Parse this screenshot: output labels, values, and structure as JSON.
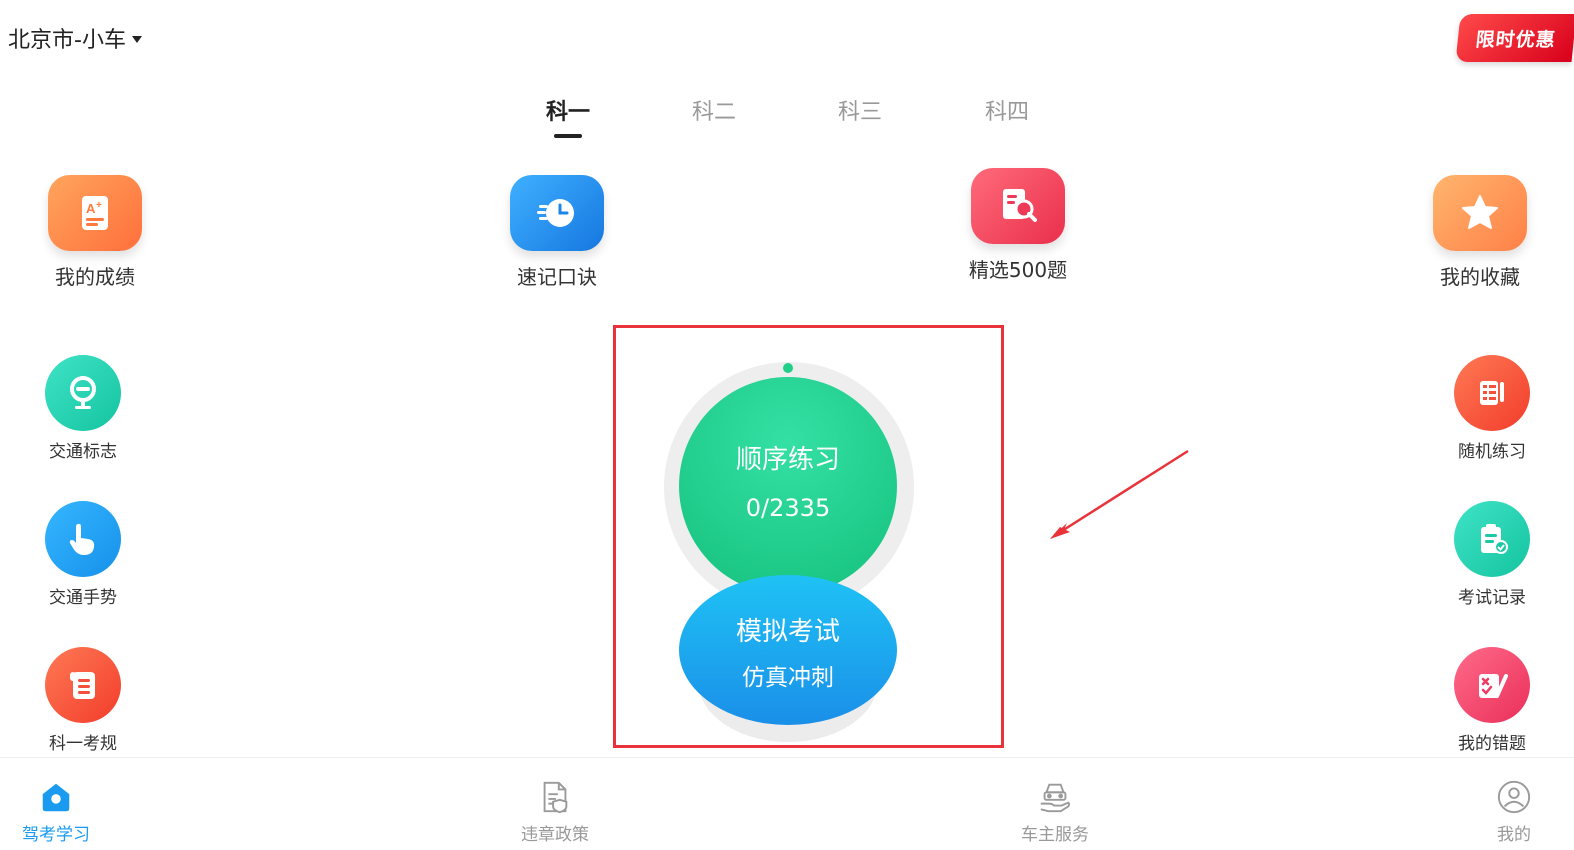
{
  "header": {
    "city": "北京市-小车",
    "promo": "限时优惠"
  },
  "tabs": [
    {
      "label": "科一",
      "active": true
    },
    {
      "label": "科二",
      "active": false
    },
    {
      "label": "科三",
      "active": false
    },
    {
      "label": "科四",
      "active": false
    }
  ],
  "features": [
    {
      "label": "我的成绩",
      "icon": "grade-icon",
      "color": "#ff8a4c"
    },
    {
      "label": "速记口诀",
      "icon": "timer-icon",
      "color": "#2196f3"
    },
    {
      "label": "精选500题",
      "icon": "search-doc-icon",
      "color": "#f2485f"
    },
    {
      "label": "我的收藏",
      "icon": "star-icon",
      "color": "#ff9a5a"
    }
  ],
  "left_tools": [
    {
      "label": "交通标志",
      "icon": "traffic-sign-icon",
      "color": "#22d3b0"
    },
    {
      "label": "交通手势",
      "icon": "hand-gesture-icon",
      "color": "#1aa4f0"
    },
    {
      "label": "科一考规",
      "icon": "rules-scroll-icon",
      "color": "#f7523e"
    }
  ],
  "right_tools": [
    {
      "label": "随机练习",
      "icon": "random-list-icon",
      "color": "#f7523e"
    },
    {
      "label": "考试记录",
      "icon": "exam-record-icon",
      "color": "#22d3b0"
    },
    {
      "label": "我的错题",
      "icon": "wrong-answers-icon",
      "color": "#f04a6e"
    }
  ],
  "practice": {
    "title": "顺序练习",
    "progress": "0/2335"
  },
  "exam": {
    "title": "模拟考试",
    "subtitle": "仿真冲刺"
  },
  "bottom_nav": [
    {
      "label": "驾考学习",
      "icon": "home-icon",
      "active": true
    },
    {
      "label": "违章政策",
      "icon": "policy-doc-icon",
      "active": false
    },
    {
      "label": "车主服务",
      "icon": "car-service-icon",
      "active": false
    },
    {
      "label": "我的",
      "icon": "profile-icon",
      "active": false
    }
  ],
  "colors": {
    "accent": "#1a9bf0",
    "highlight": "#e8333a",
    "practice": "#1fcf8a"
  }
}
